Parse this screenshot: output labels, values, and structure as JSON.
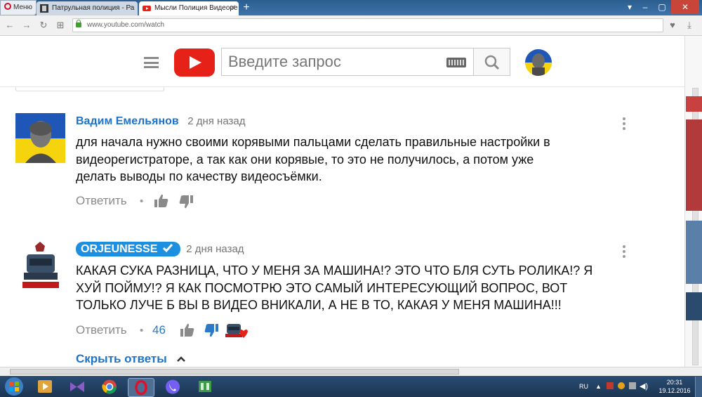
{
  "browser": {
    "menu_label": "Меню",
    "tabs": [
      {
        "title": "Патрульная полиция - Ра",
        "active": false
      },
      {
        "title": "Мысли Полиция Видеоре",
        "active": true
      }
    ],
    "url": "www.youtube.com/watch"
  },
  "youtube": {
    "search_placeholder": "Введите запрос"
  },
  "comments": [
    {
      "author": "Вадим Емельянов",
      "time": "2 дня назад",
      "text_lines": [
        "для начала нужно своими корявыми пальцами сделать правильные настройки в",
        "видеорегистраторе, а так как они корявые, то это не получилось, а потом уже",
        "делать выводы по качеству видеосъёмки."
      ],
      "reply_label": "Ответить",
      "likes": ""
    },
    {
      "author": "ORJEUNESSE",
      "verified": true,
      "time": "2 дня назад",
      "text_lines": [
        "КАКАЯ СУКА РАЗНИЦА, ЧТО У МЕНЯ ЗА МАШИНА!? ЭТО ЧТО БЛЯ СУТЬ РОЛИКА!? Я",
        "ХУЙ ПОЙМУ!? Я КАК ПОСМОТРЮ ЭТО САМЫЙ ИНТЕРЕСУЮЩИЙ ВОПРОС, ВОТ",
        "ТОЛЬКО ЛУЧЕ Б ВЫ В ВИДЕО ВНИКАЛИ, А НЕ В ТО, КАКАЯ У МЕНЯ МАШИНА!!!"
      ],
      "reply_label": "Ответить",
      "likes": "46",
      "hide_replies": "Скрыть ответы"
    }
  ],
  "taskbar": {
    "lang": "RU",
    "time": "20:31",
    "date": "19.12.2016"
  },
  "colors": {
    "youtube_red": "#e62117",
    "link_blue": "#1d73c9",
    "badge_blue": "#1d8fe1",
    "ukraine_blue": "#1f57b8",
    "ukraine_yellow": "#f5d40e"
  }
}
